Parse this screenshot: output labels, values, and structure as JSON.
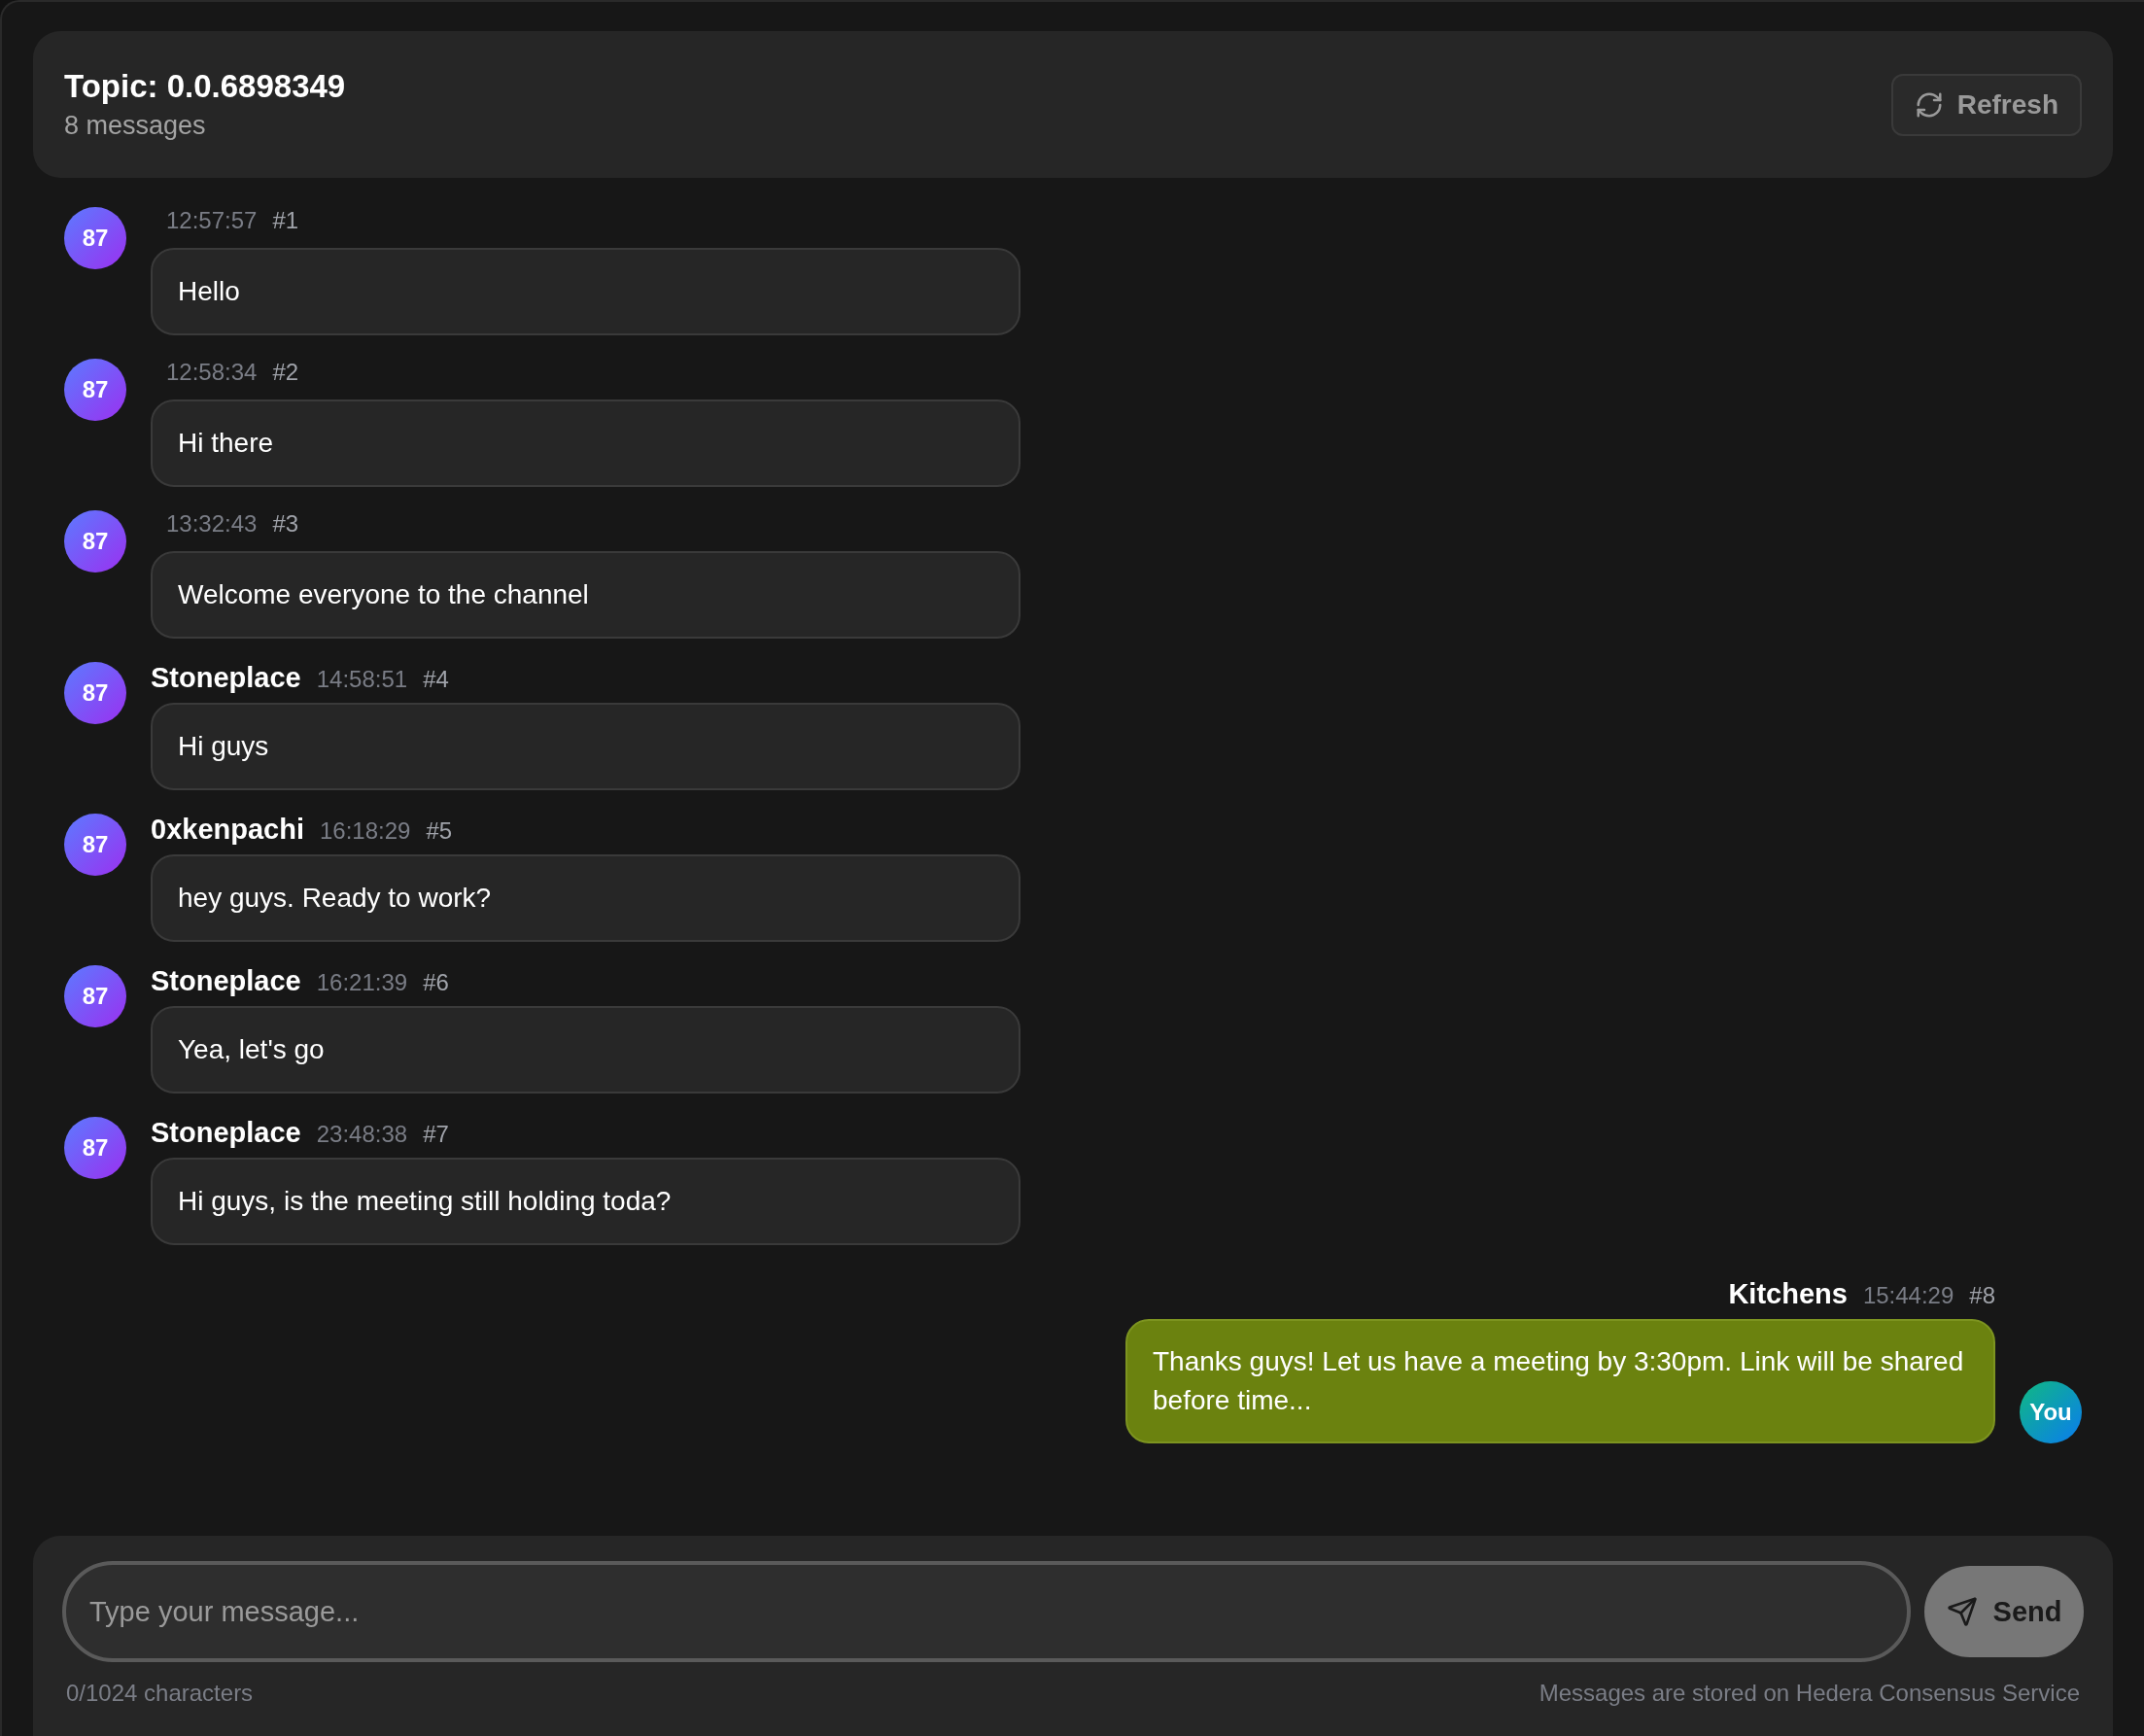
{
  "header": {
    "title": "Topic: 0.0.6898349",
    "subtitle": "8 messages",
    "refresh_button": "Refresh"
  },
  "messages": [
    {
      "kind": "theirs",
      "avatar": "87",
      "time": "12:57:57",
      "number": "#1",
      "text": "Hello"
    },
    {
      "kind": "theirs",
      "avatar": "87",
      "time": "12:58:34",
      "number": "#2",
      "text": "Hi there"
    },
    {
      "kind": "theirs",
      "avatar": "87",
      "time": "13:32:43",
      "number": "#3",
      "text": "Welcome everyone to the channel"
    },
    {
      "kind": "theirs",
      "avatar": "87",
      "sender": "Stoneplace",
      "time": "14:58:51",
      "number": "#4",
      "text": "Hi guys"
    },
    {
      "kind": "theirs",
      "avatar": "87",
      "sender": "0xkenpachi",
      "time": "16:18:29",
      "number": "#5",
      "text": "hey guys. Ready to work?"
    },
    {
      "kind": "theirs",
      "avatar": "87",
      "sender": "Stoneplace",
      "time": "16:21:39",
      "number": "#6",
      "text": "Yea, let's go"
    },
    {
      "kind": "theirs",
      "avatar": "87",
      "sender": "Stoneplace",
      "time": "23:48:38",
      "number": "#7",
      "text": "Hi guys, is the meeting still holding toda?"
    },
    {
      "kind": "mine",
      "avatar": "You",
      "sender": "Kitchens",
      "time": "15:44:29",
      "number": "#8",
      "text": "Thanks guys! Let us have a meeting by 3:30pm. Link will be shared before time..."
    }
  ],
  "composer": {
    "placeholder": "Type your message...",
    "send_button": "Send",
    "char_count": "0/1024 characters",
    "note": "Messages are stored on Hedera Consensus Service"
  }
}
